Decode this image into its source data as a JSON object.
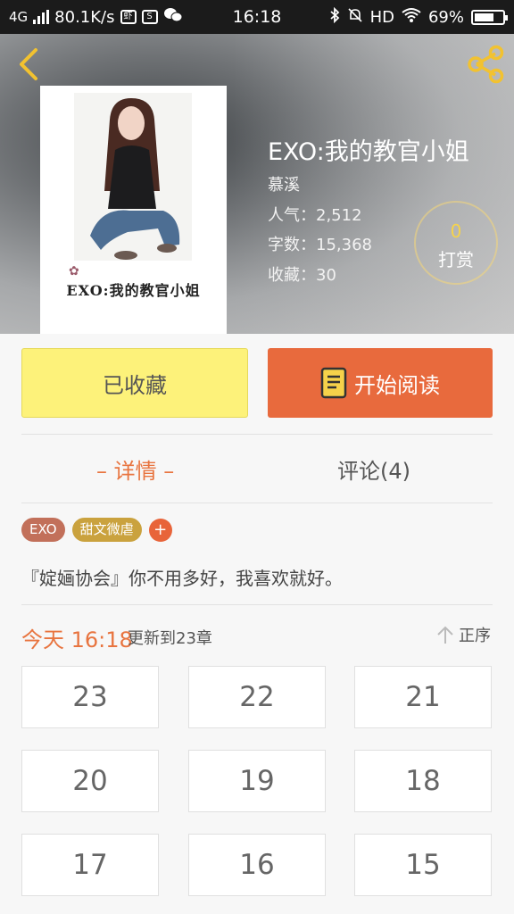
{
  "status_bar": {
    "network": "4G",
    "speed": "80.1K/s",
    "time": "16:18",
    "hd": "HD",
    "battery": "69%",
    "battery_level": 0.69
  },
  "header": {
    "back_icon": "chevron-left-icon",
    "share_icon": "share-icon",
    "icon_color": "#f2c230"
  },
  "book": {
    "title": "EXO:我的教官小姐",
    "author": "慕溪",
    "cover_caption": "EXO:我的教官小姐",
    "popularity": "人气：2,512",
    "word_count": "字数：15,368",
    "favorites": "收藏：30"
  },
  "tip": {
    "count": "0",
    "label": "打赏"
  },
  "actions": {
    "favorited_label": "已收藏",
    "read_label": "开始阅读",
    "read_icon": "book-icon"
  },
  "tabs": {
    "details": "– 详情 –",
    "comments": "评论(4)"
  },
  "tags": [
    "EXO",
    "甜文微虐"
  ],
  "add_tag": "+",
  "description": "『婝婳协会』你不用多好，我喜欢就好。",
  "update": {
    "time": "今天 16:18",
    "text": "更新到23章",
    "sort_label": "正序"
  },
  "chapters": [
    "23",
    "22",
    "21",
    "20",
    "19",
    "18",
    "17",
    "16",
    "15"
  ],
  "colors": {
    "accent": "#e8743f",
    "favorite_button": "#fdf27a",
    "read_button": "#e86a3d"
  }
}
